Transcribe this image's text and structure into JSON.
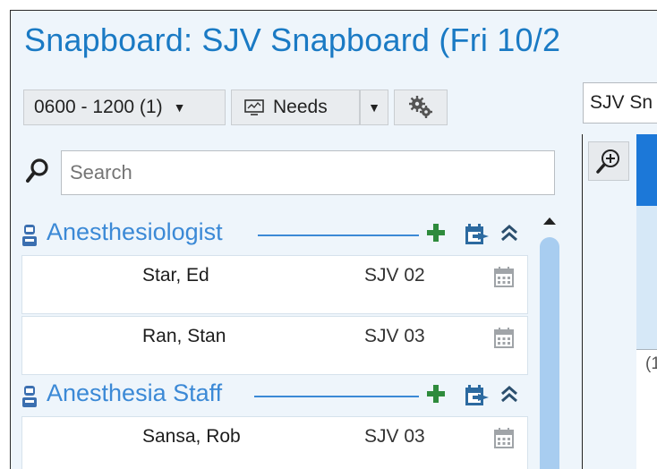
{
  "title": "Snapboard: SJV Snapboard (Fri 10/2",
  "toolbar": {
    "time_range": "0600 - 1200 (1)",
    "needs_label": "Needs"
  },
  "search": {
    "placeholder": "Search"
  },
  "groups": [
    {
      "name": "Anesthesiologist",
      "rows": [
        {
          "name": "Star, Ed",
          "room": "SJV 02"
        },
        {
          "name": "Ran, Stan",
          "room": "SJV 03"
        }
      ]
    },
    {
      "name": "Anesthesia Staff",
      "rows": [
        {
          "name": "Sansa, Rob",
          "room": "SJV 03"
        }
      ]
    }
  ],
  "right": {
    "select_value": "SJV Sn",
    "fragment": "(1"
  },
  "colors": {
    "title": "#1a7ac4",
    "group": "#3b89d6",
    "add": "#2e8b3c",
    "accent": "#1c78d8"
  },
  "icons": [
    "caret-down-icon",
    "monitor-icon",
    "gear-icon",
    "search-icon",
    "person-icon",
    "add-icon",
    "calendar-swap-icon",
    "collapse-icon",
    "calendar-icon",
    "zoom-in-icon"
  ]
}
